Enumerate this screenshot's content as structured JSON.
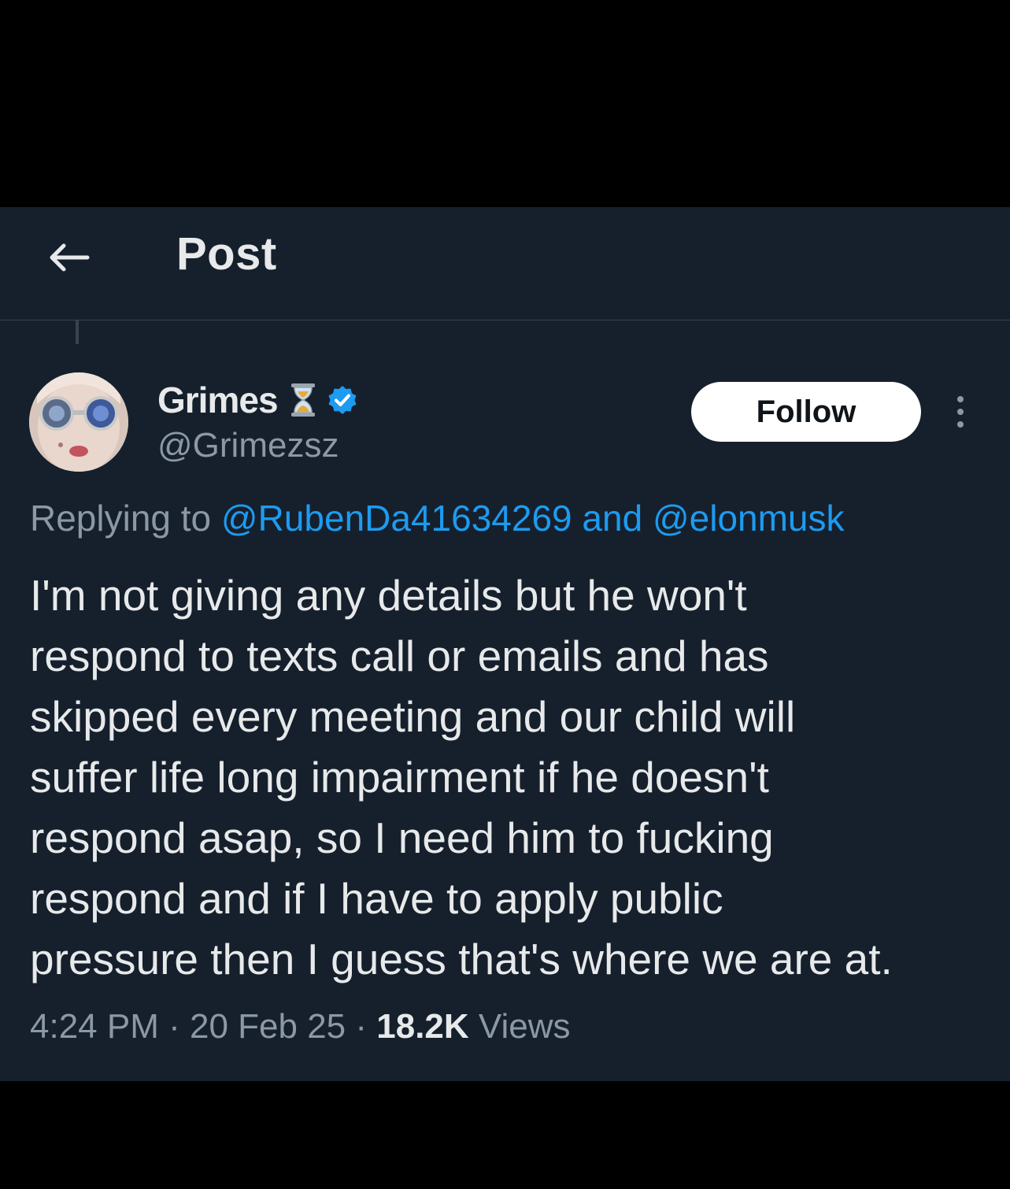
{
  "header": {
    "title": "Post",
    "back_icon": "arrow-left-icon"
  },
  "author": {
    "display_name": "Grimes",
    "emoji": "hourglass-icon",
    "verified_icon": "verified-badge-icon",
    "verified_color": "#1d9bf0",
    "handle": "@Grimezsz"
  },
  "actions": {
    "follow_label": "Follow",
    "more_icon": "more-vertical-icon"
  },
  "reply_context": {
    "prefix": "Replying to ",
    "mention_1": "@RubenDa41634269",
    "joiner": " and ",
    "mention_2": "@elonmusk"
  },
  "tweet": {
    "text": "I'm not giving any details but he won't\nrespond to texts call or emails and has\nskipped every meeting and our child will\nsuffer life long impairment if he doesn't\nrespond asap, so I need him to fucking\nrespond and if I have to apply public\npressure then I guess that's where we are at."
  },
  "meta": {
    "time": "4:24 PM",
    "sep1": " · ",
    "date": "20 Feb 25",
    "sep2": " · ",
    "views_count": "18.2K",
    "views_label": " Views"
  },
  "colors": {
    "background": "#16202c",
    "text": "#e7e9ea",
    "muted": "#8b98a5",
    "link": "#1d9bf0",
    "border": "#38444d"
  }
}
